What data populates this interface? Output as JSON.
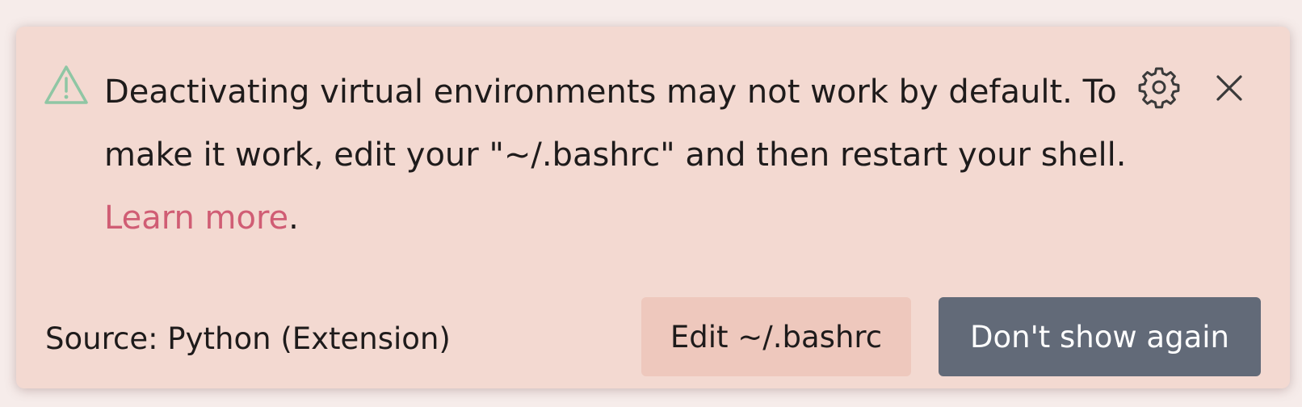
{
  "notification": {
    "message": "Deactivating virtual environments may not work by default. To make it work, edit your \"~/.bashrc\" and then restart your shell.",
    "link_text": "Learn more",
    "link_suffix": ".",
    "source": "Source: Python (Extension)",
    "icon": "warning-icon",
    "actions": {
      "secondary_label": "Edit ~/.bashrc",
      "primary_label": "Don't show again"
    },
    "toolbar": {
      "settings_icon": "gear-icon",
      "close_icon": "close-icon"
    }
  },
  "colors": {
    "background": "#f3d9d1",
    "warning": "#8fc6a4",
    "link": "#d05d74",
    "primary_button": "#626a78",
    "secondary_button": "#eec8bd"
  }
}
